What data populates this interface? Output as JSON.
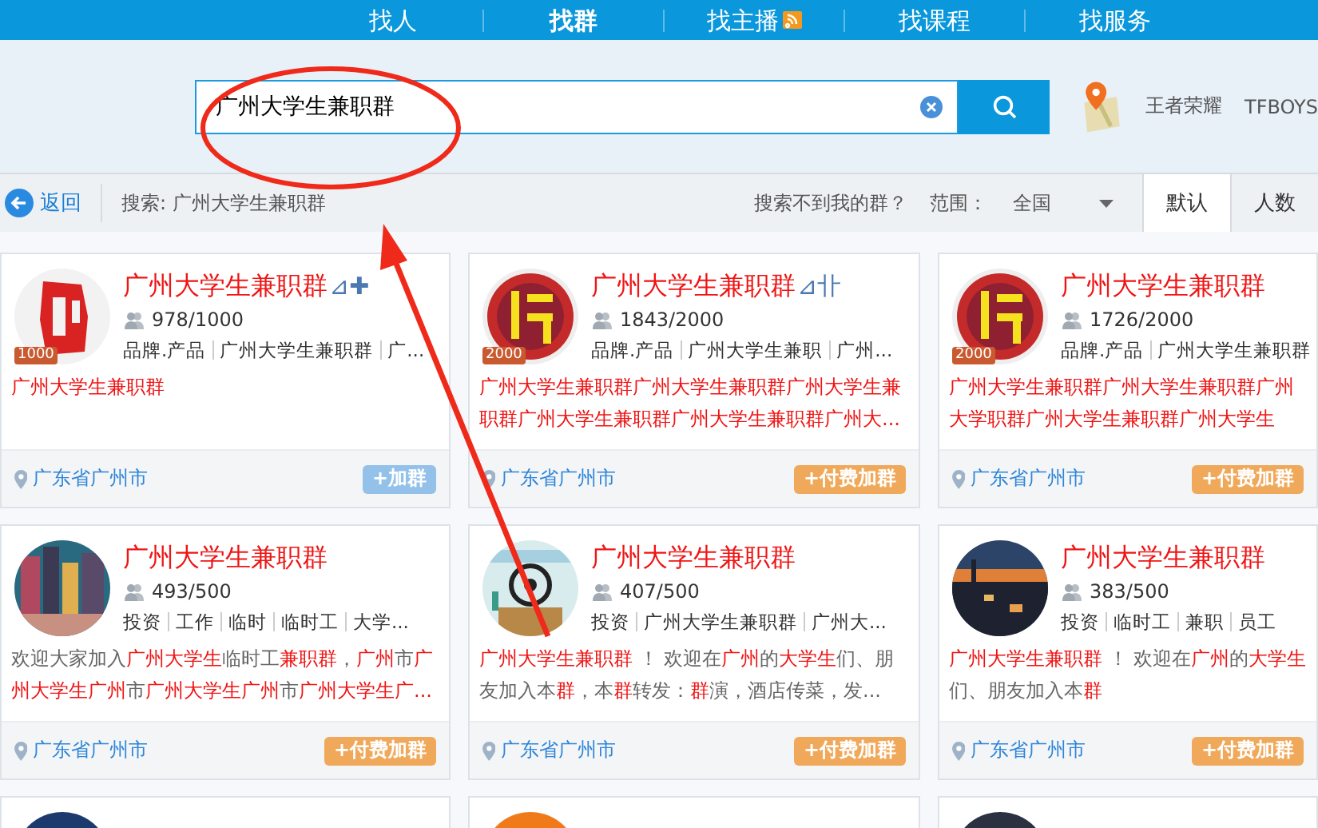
{
  "nav": [
    {
      "label": "找人",
      "selected": false,
      "kind": "plain"
    },
    {
      "label": "找群",
      "selected": true,
      "kind": "plain"
    },
    {
      "label": "找主播",
      "selected": false,
      "kind": "badged"
    },
    {
      "label": "找课程",
      "selected": false,
      "kind": "plain"
    },
    {
      "label": "找服务",
      "selected": false,
      "kind": "plain"
    }
  ],
  "search": {
    "value": "广州大学生兼职群",
    "hot_words": [
      "王者荣耀",
      "TFBOYS"
    ]
  },
  "filter_bar": {
    "back": "返回",
    "query": "搜索: 广州大学生兼职群",
    "help": "搜索不到我的群？",
    "range_label": "范围：",
    "range_value": "全国",
    "sort_tabs": [
      {
        "label": "默认",
        "selected": true
      },
      {
        "label": "人数",
        "selected": false
      }
    ]
  },
  "groups": [
    {
      "title": "广州大学生兼职群",
      "suffix": "⊿✚",
      "avatar": {
        "kind": "picture"
      },
      "level": "1000",
      "members": "978/1000",
      "tags": [
        "品牌.产品",
        "广州大学生兼职群",
        "广..."
      ],
      "description": [
        {
          "text": "广州大学生兼职群",
          "highlight": true
        }
      ],
      "location": "广东省广州市",
      "button": {
        "label": "+加群",
        "kind": "free"
      }
    },
    {
      "title": "广州大学生兼职群",
      "suffix": "⊿卝",
      "avatar": {
        "kind": "picture"
      },
      "level": "2000",
      "members": "1843/2000",
      "tags": [
        "品牌.产品",
        "广州大学生兼职",
        "广州..."
      ],
      "description": [
        {
          "text": "广州大学生兼职群广州大学生兼职群广州大学生兼职群广州大学生兼职群广州大学生兼职群广州大...",
          "highlight": true
        }
      ],
      "location": "广东省广州市",
      "button": {
        "label": "+付费加群",
        "kind": "paid"
      }
    },
    {
      "title": "广州大学生兼职群",
      "avatar": {
        "kind": "picture"
      },
      "level": "2000",
      "members": "1726/2000",
      "tags": [
        "品牌.产品",
        "广州大学生兼职群"
      ],
      "description": [
        {
          "text": "广州大学生兼职群广州大学生兼职群广州大学职群广州大学生兼职群广州大学生",
          "highlight": true
        }
      ],
      "location": "广东省广州市",
      "button": {
        "label": "+付费加群",
        "kind": "paid"
      }
    },
    {
      "title": "广州大学生兼职群",
      "avatar": {
        "kind": "picture"
      },
      "members": "493/500",
      "tags": [
        "投资",
        "工作",
        "临时",
        "临时工",
        "大学..."
      ],
      "description": [
        {
          "text": "欢迎大家加入",
          "highlight": false
        },
        {
          "text": "广州大学生",
          "highlight": true
        },
        {
          "text": "临时工",
          "highlight": false
        },
        {
          "text": "兼职群",
          "highlight": true
        },
        {
          "text": "，",
          "highlight": false
        },
        {
          "text": "广州",
          "highlight": true
        },
        {
          "text": "市",
          "highlight": false
        },
        {
          "text": "广州大学生广州",
          "highlight": true
        },
        {
          "text": "市",
          "highlight": false
        },
        {
          "text": "广州大学生广州",
          "highlight": true
        },
        {
          "text": "市",
          "highlight": false
        },
        {
          "text": "广州大学生广...",
          "highlight": true
        }
      ],
      "location": "广东省广州市",
      "button": {
        "label": "+付费加群",
        "kind": "paid"
      }
    },
    {
      "title": "广州大学生兼职群",
      "avatar": {
        "kind": "picture"
      },
      "members": "407/500",
      "tags": [
        "投资",
        "广州大学生兼职群",
        "广州大..."
      ],
      "description": [
        {
          "text": "广州大学生兼职群",
          "highlight": true
        },
        {
          "text": " ！ 欢迎在",
          "highlight": false
        },
        {
          "text": "广州",
          "highlight": true
        },
        {
          "text": "的",
          "highlight": false
        },
        {
          "text": "大学生",
          "highlight": true
        },
        {
          "text": "们、朋友加入本",
          "highlight": false
        },
        {
          "text": "群",
          "highlight": true
        },
        {
          "text": "，本",
          "highlight": false
        },
        {
          "text": "群",
          "highlight": true
        },
        {
          "text": "转发：",
          "highlight": false
        },
        {
          "text": "群",
          "highlight": true
        },
        {
          "text": "演，酒店传菜，发...",
          "highlight": false
        }
      ],
      "location": "广东省广州市",
      "button": {
        "label": "+付费加群",
        "kind": "paid"
      }
    },
    {
      "title": "广州大学生兼职群",
      "avatar": {
        "kind": "picture"
      },
      "members": "383/500",
      "tags": [
        "投资",
        "临时工",
        "兼职",
        "员工"
      ],
      "description": [
        {
          "text": "广州大学生兼职群",
          "highlight": true
        },
        {
          "text": " ！ 欢迎在",
          "highlight": false
        },
        {
          "text": "广州",
          "highlight": true
        },
        {
          "text": "的",
          "highlight": false
        },
        {
          "text": "大学生",
          "highlight": true
        },
        {
          "text": "们、朋友加入本",
          "highlight": false
        },
        {
          "text": "群",
          "highlight": true
        }
      ],
      "location": "广东省广州市",
      "button": {
        "label": "+付费加群",
        "kind": "paid"
      }
    },
    {
      "avatar": {
        "kind": "picture"
      }
    },
    {
      "avatar": {
        "kind": "picture"
      }
    },
    {
      "avatar": {
        "kind": "picture"
      }
    }
  ]
}
